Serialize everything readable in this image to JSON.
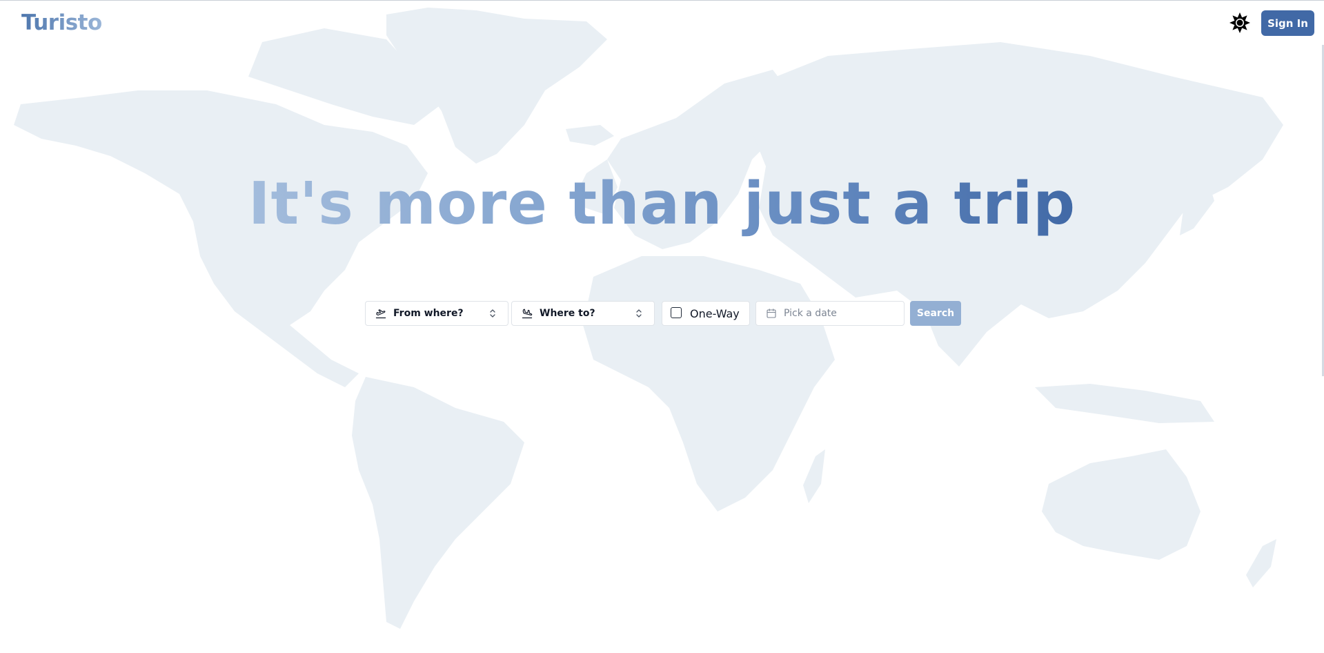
{
  "app": {
    "logo_text": "Turisto"
  },
  "header": {
    "theme_icon": "sun-icon",
    "signin_label": "Sign In"
  },
  "hero": {
    "headline": "It's more than just a trip"
  },
  "search": {
    "from_placeholder": "From where?",
    "from_icon": "plane-takeoff-icon",
    "to_placeholder": "Where to?",
    "to_icon": "plane-landing-icon",
    "chevron_icon": "chevrons-up-down-icon",
    "oneway_label": "One-Way",
    "oneway_checked": false,
    "date_placeholder": "Pick a date",
    "date_icon": "calendar-icon",
    "search_label": "Search"
  },
  "background": {
    "image": "world-map",
    "map_color": "#e9eff4"
  },
  "colors": {
    "brand": "#4169a6",
    "brand_light": "#93afd3",
    "gradient_start": "#a3bcdc"
  }
}
